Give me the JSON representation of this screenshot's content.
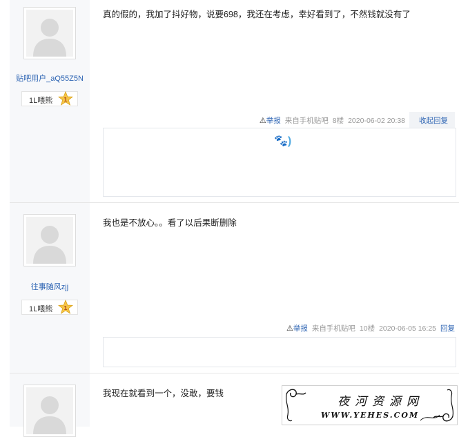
{
  "posts": [
    {
      "username": "贴吧用户_aQ55Z5N",
      "level_name": "1L喂熊",
      "level_number": "1",
      "content": "真的假的，我加了抖好物，说要698，我还在考虑，幸好看到了，不然钱就没有了",
      "report_label": "举报",
      "source": "来自手机贴吧",
      "floor": "8楼",
      "timestamp": "2020-06-02 20:38",
      "reply_label": "收起回复",
      "reply_emoji": "🐾)"
    },
    {
      "username": "往事随风zjj",
      "level_name": "1L喂熊",
      "level_number": "1",
      "content": "我也是不放心。。看了以后果断删除",
      "report_label": "举报",
      "source": "来自手机贴吧",
      "floor": "10楼",
      "timestamp": "2020-06-05 16:25",
      "reply_label": "回复"
    },
    {
      "content": "我现在就看到一个，没敢，要钱"
    }
  ],
  "watermark": {
    "title": "夜河资源网",
    "url": "WWW.YEHES.COM"
  },
  "colors": {
    "link": "#2d64b3",
    "meta": "#999999",
    "sidebar_bg": "#f7f8fa"
  },
  "icons": {
    "avatar": "default-user-avatar-icon",
    "level": "gold-star-level-icon",
    "report": "warning-triangle-icon"
  }
}
